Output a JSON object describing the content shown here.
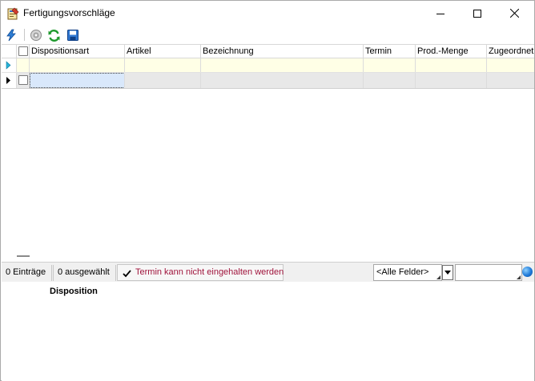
{
  "window": {
    "title": "Fertigungsvorschläge"
  },
  "toolbar": {
    "icons": [
      "lightning-icon",
      "disc-icon",
      "refresh-icon",
      "save-icon"
    ]
  },
  "grid": {
    "columns": [
      "Dispositionsart",
      "Artikel",
      "Bezeichnung",
      "Termin",
      "Prod.-Menge",
      "Zugeordnet"
    ]
  },
  "status": {
    "entries": "0 Einträge",
    "selected": "0 ausgewählt",
    "warning": "Termin kann nicht eingehalten werden",
    "field_filter": "<Alle Felder>",
    "search_value": ""
  },
  "detail": {
    "title": "Disposition"
  },
  "colors": {
    "warning_text": "#a0143c",
    "filter_row": "#ffffe6",
    "selected_row": "#e8e8e8",
    "focus_cell": "#d9e8fb"
  }
}
